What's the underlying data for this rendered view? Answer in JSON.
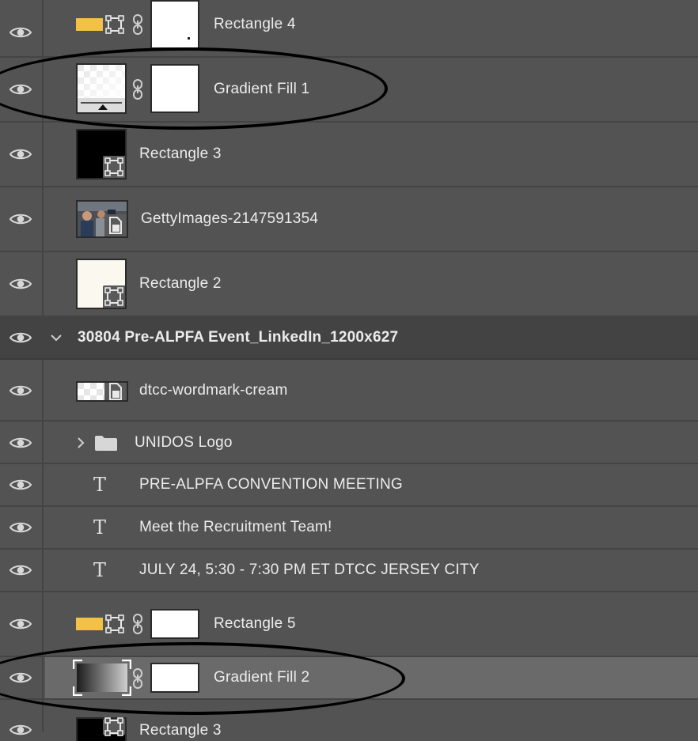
{
  "layers": {
    "rectangle4": {
      "name": "Rectangle 4"
    },
    "gradient_fill1": {
      "name": "Gradient Fill 1"
    },
    "rectangle3": {
      "name": "Rectangle 3"
    },
    "getty": {
      "name": "GettyImages-2147591354"
    },
    "rectangle2": {
      "name": "Rectangle 2"
    },
    "group": {
      "name": "30804 Pre-ALPFA Event_LinkedIn_1200x627"
    },
    "wordmark": {
      "name": "dtcc-wordmark-cream"
    },
    "unidos": {
      "name": "UNIDOS Logo"
    },
    "text1": {
      "name": "PRE-ALPFA CONVENTION MEETING"
    },
    "text2": {
      "name": "Meet the Recruitment Team!"
    },
    "text3": {
      "name": "JULY 24, 5:30 - 7:30 PM ET DTCC JERSEY CITY"
    },
    "rectangle5": {
      "name": "Rectangle 5"
    },
    "gradient_fill2": {
      "name": "Gradient Fill 2"
    },
    "rectangle3b": {
      "name": "Rectangle 3"
    }
  },
  "icons": {
    "visibility": "eye-icon",
    "link": "chain-link-icon",
    "shape": "vector-shape-icon",
    "smart_object": "smart-object-icon",
    "text_layer": "text-layer-icon",
    "folder": "folder-icon",
    "disclosure": "chevron-icon"
  },
  "colors": {
    "panel_bg": "#535353",
    "group_bg": "#434343",
    "selected_bg": "#6a6a6a",
    "fill_swatch": "#f3c244",
    "annotation": "#000000"
  },
  "text_glyph": "T"
}
